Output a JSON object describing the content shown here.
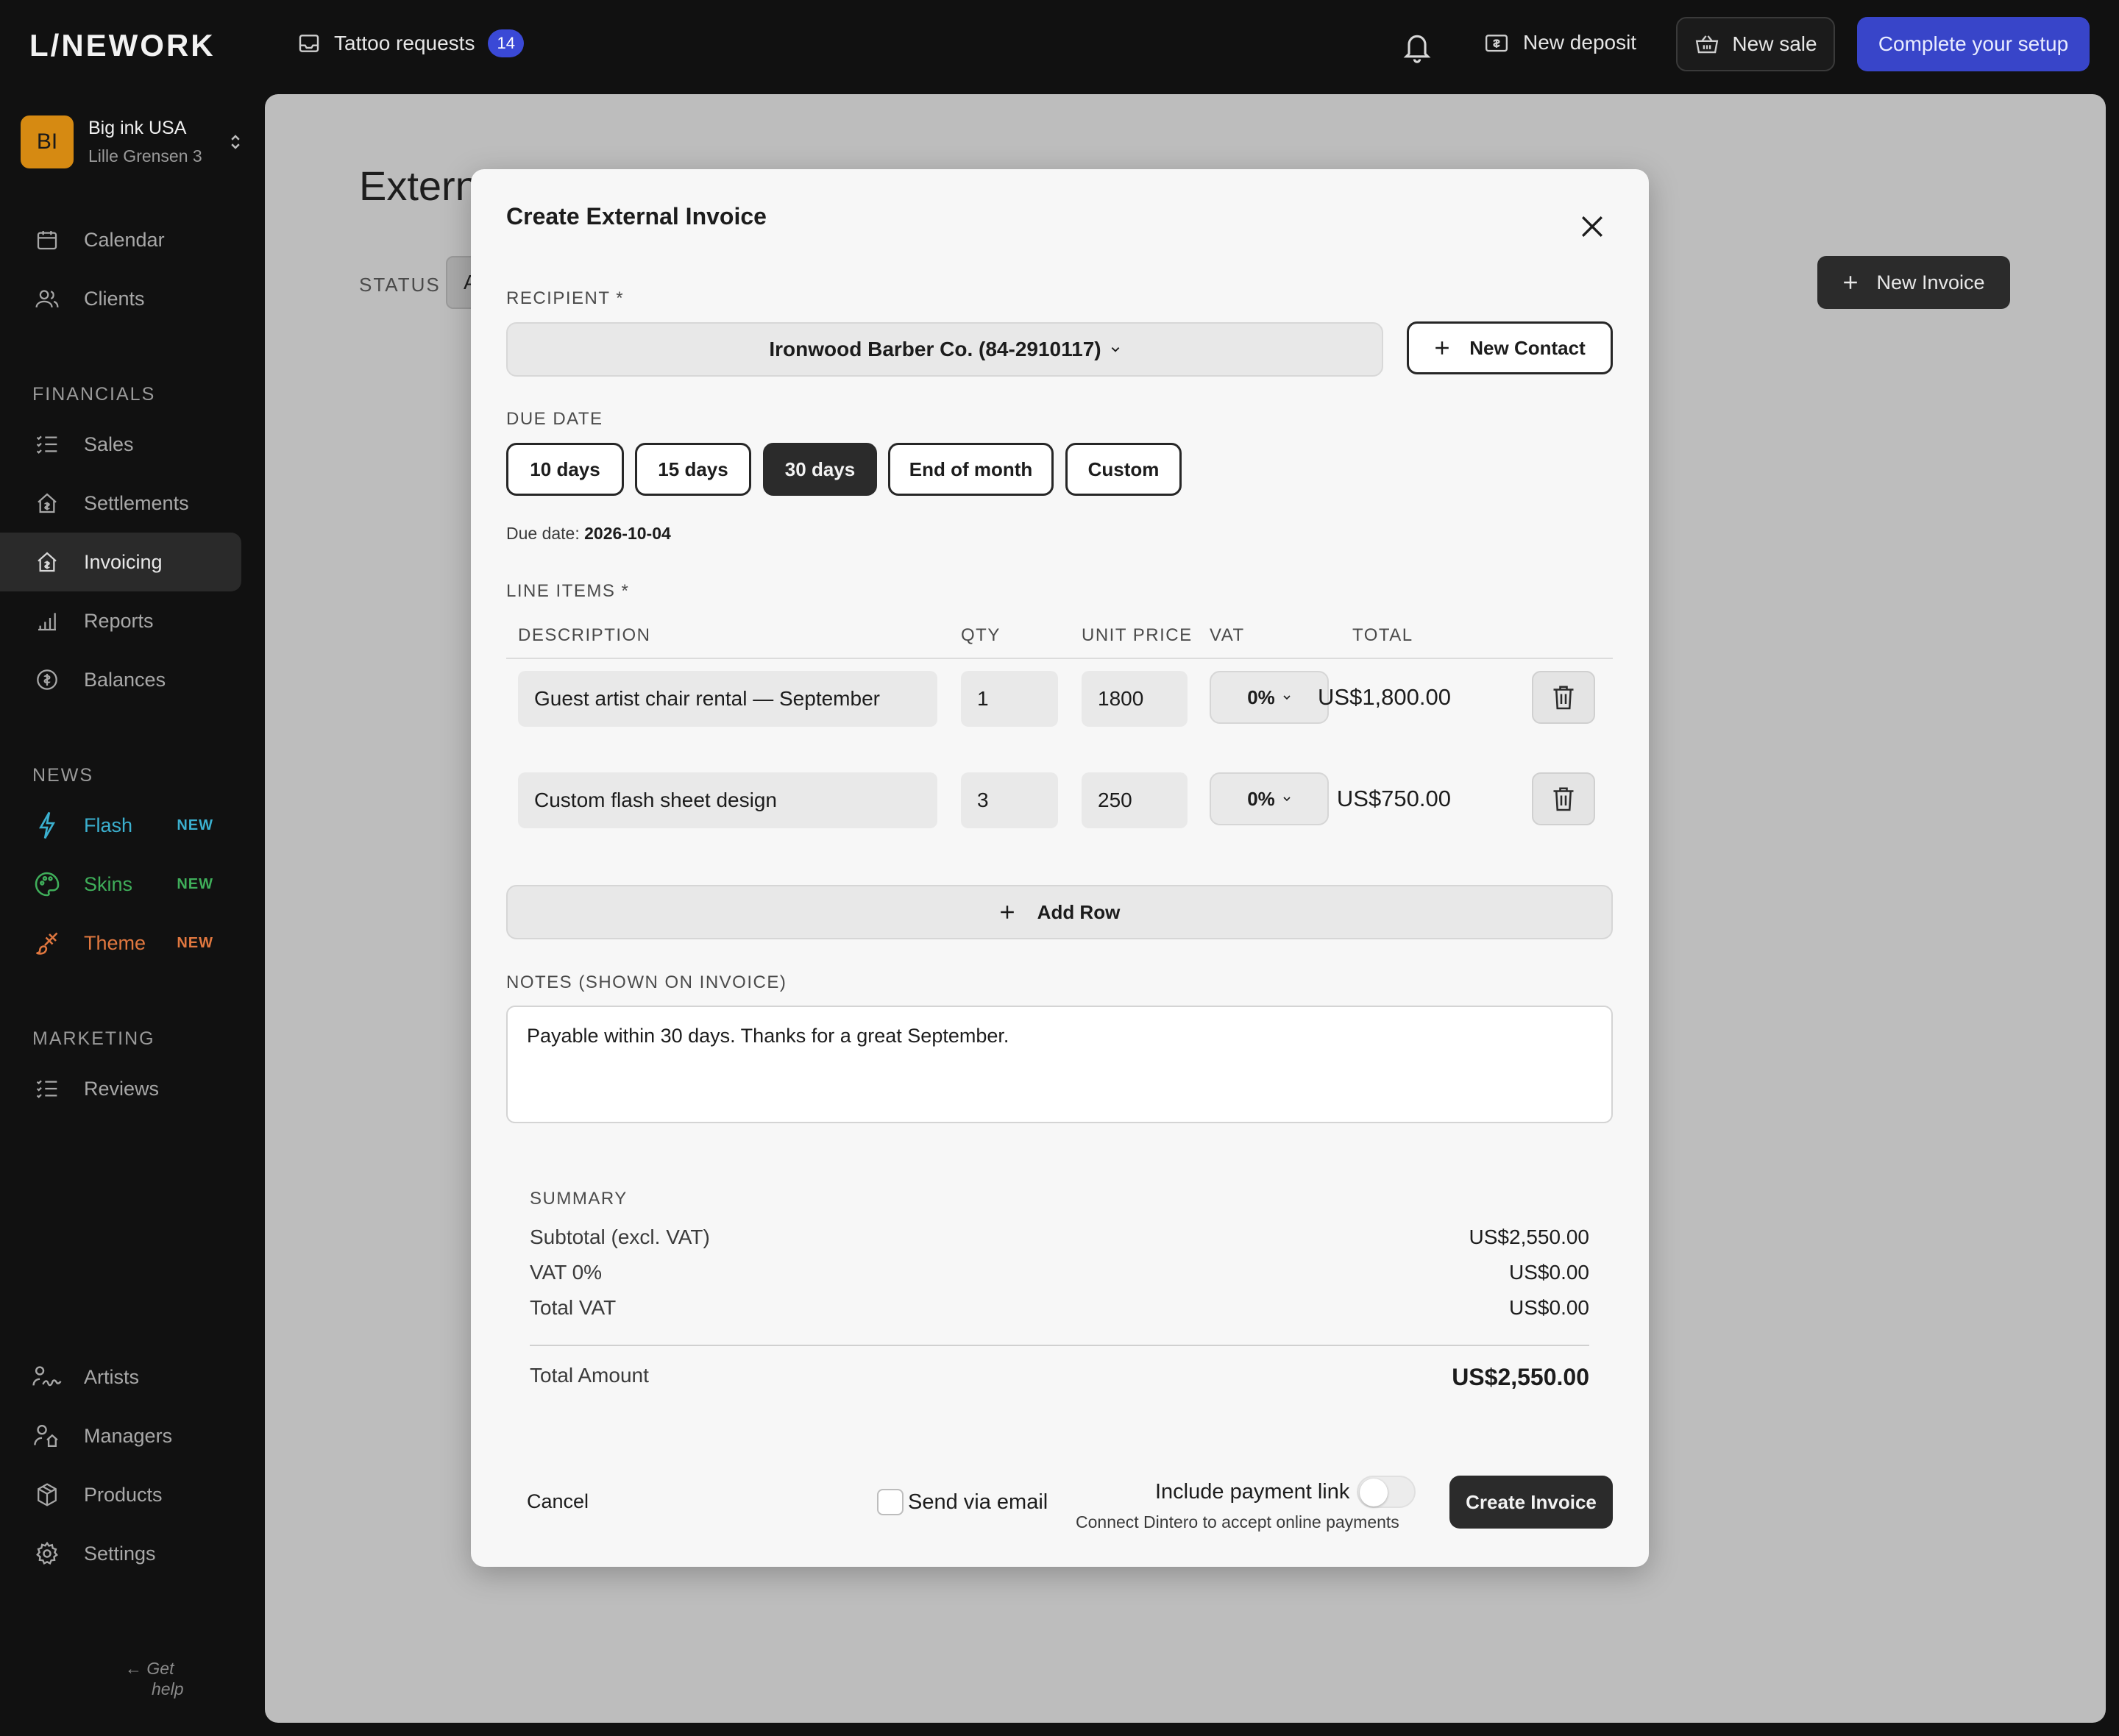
{
  "topbar": {
    "logo": "L/NEWORK",
    "tattoo_requests_label": "Tattoo requests",
    "tattoo_requests_count": "14",
    "new_deposit_label": "New deposit",
    "new_sale_label": "New sale",
    "complete_setup_label": "Complete your setup"
  },
  "account": {
    "initials": "BI",
    "name": "Big ink USA",
    "address": "Lille Grensen 3"
  },
  "sidebar": {
    "calendar": "Calendar",
    "clients": "Clients",
    "financials_header": "FINANCIALS",
    "sales": "Sales",
    "settlements": "Settlements",
    "invoicing": "Invoicing",
    "reports": "Reports",
    "balances": "Balances",
    "news_header": "NEWS",
    "flash": "Flash",
    "skins": "Skins",
    "theme": "Theme",
    "new_tag": "NEW",
    "marketing_header": "MARKETING",
    "reviews": "Reviews",
    "artists": "Artists",
    "managers": "Managers",
    "products": "Products",
    "settings": "Settings",
    "help_line1": "Get",
    "help_line2": "help",
    "colors": {
      "flash": "#3bb0cf",
      "skins": "#3fae5a",
      "theme": "#e0773f"
    }
  },
  "main": {
    "title_visible": "Extern",
    "status_label": "STATUS",
    "status_value_visible": "A",
    "new_invoice_label": "New Invoice"
  },
  "modal": {
    "title": "Create External Invoice",
    "recipient_label": "RECIPIENT *",
    "recipient_value": "Ironwood Barber Co. (84-2910117)",
    "new_contact_label": "New Contact",
    "due_date_label": "DUE DATE",
    "due_options": [
      "10 days",
      "15 days",
      "30 days",
      "End of month",
      "Custom"
    ],
    "due_selected": "30 days",
    "due_date_prefix": "Due date:",
    "due_date_value": "2026-10-04",
    "line_items_label": "LINE ITEMS *",
    "columns": [
      "DESCRIPTION",
      "QTY",
      "UNIT PRICE",
      "VAT",
      "TOTAL"
    ],
    "rows": [
      {
        "description": "Guest artist chair rental — September",
        "qty": "1",
        "unit_price": "1800",
        "vat": "0%",
        "total": "US$1,800.00"
      },
      {
        "description": "Custom flash sheet design",
        "qty": "3",
        "unit_price": "250",
        "vat": "0%",
        "total": "US$750.00"
      }
    ],
    "add_row_label": "Add Row",
    "notes_label": "NOTES (SHOWN ON INVOICE)",
    "notes_value": "Payable within 30 days. Thanks for a great September.",
    "summary_label": "SUMMARY",
    "subtotal_label": "Subtotal (excl. VAT)",
    "subtotal_value": "US$2,550.00",
    "vat_label": "VAT 0%",
    "vat_value": "US$0.00",
    "total_vat_label": "Total VAT",
    "total_vat_value": "US$0.00",
    "total_amount_label": "Total Amount",
    "total_amount_value": "US$2,550.00",
    "cancel_label": "Cancel",
    "send_email_label": "Send via email",
    "send_email_checked": false,
    "payment_link_label": "Include payment link",
    "payment_link_enabled": false,
    "payment_link_sub": "Connect Dintero to accept online payments",
    "create_label": "Create Invoice"
  }
}
